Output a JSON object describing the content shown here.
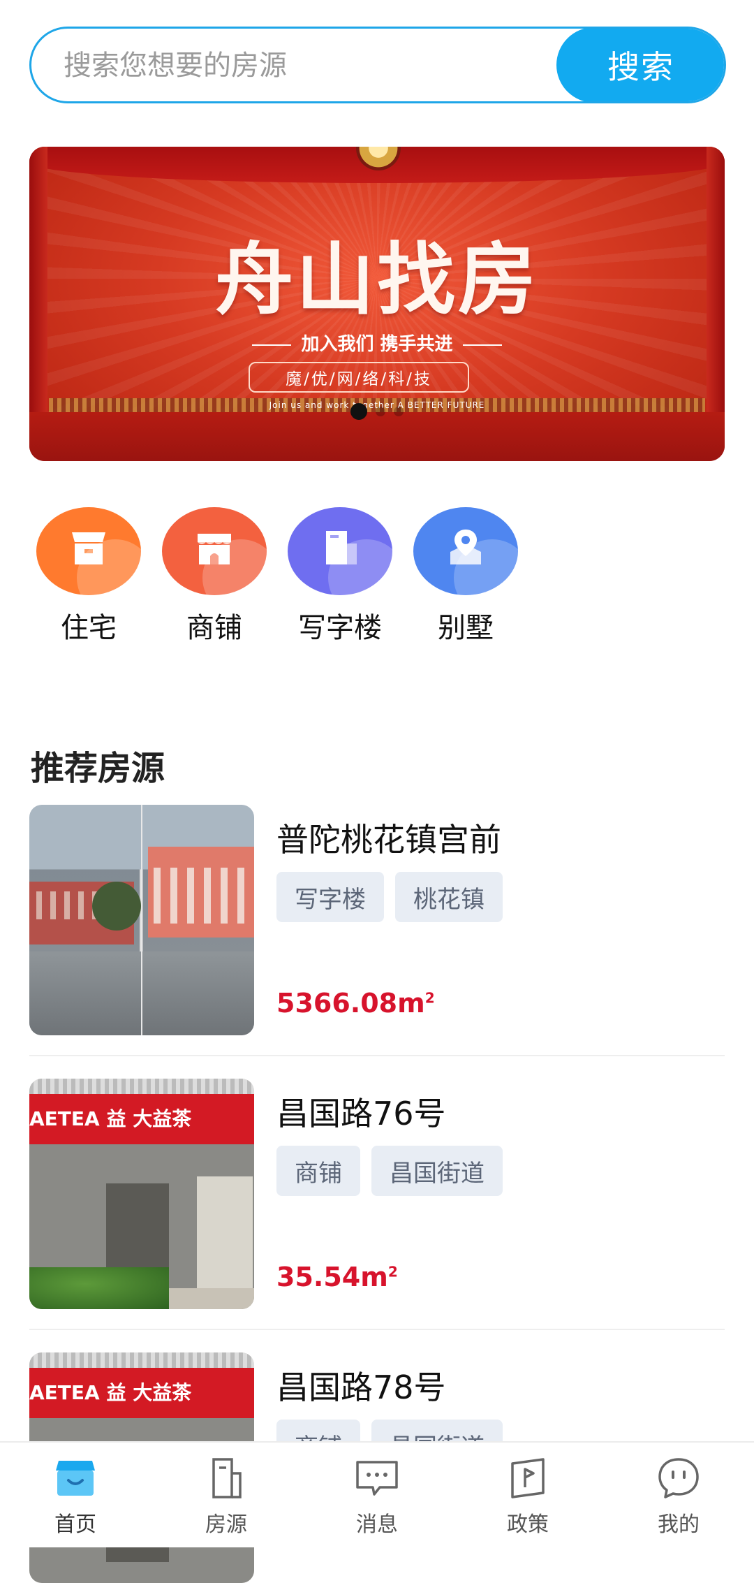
{
  "search": {
    "placeholder": "搜索您想要的房源",
    "button_label": "搜索"
  },
  "banner": {
    "title": "舟山找房",
    "subtitle": "加入我们 携手共进",
    "tag": "魔/优/网/络/科/技",
    "english": "Join us and work together A BETTER FUTURE",
    "slide_count": 3,
    "active_slide": 1
  },
  "categories": [
    {
      "label": "住宅",
      "icon": "house-icon",
      "color": "#ff7a2e"
    },
    {
      "label": "商铺",
      "icon": "storefront-icon",
      "color": "#f3613f"
    },
    {
      "label": "写字楼",
      "icon": "office-building-icon",
      "color": "#6f6ef0"
    },
    {
      "label": "别墅",
      "icon": "map-pin-icon",
      "color": "#4f86f0"
    }
  ],
  "section": {
    "title": "推荐房源"
  },
  "listings": [
    {
      "name": "普陀桃花镇宫前",
      "tags": [
        "写字楼",
        "桃花镇"
      ],
      "area": "5366.08",
      "unit": "m",
      "unit_sup": "2"
    },
    {
      "name": "昌国路76号",
      "tags": [
        "商铺",
        "昌国街道"
      ],
      "area": "35.54",
      "unit": "m",
      "unit_sup": "2"
    },
    {
      "name": "昌国路78号",
      "tags": [
        "商铺",
        "昌国街道"
      ],
      "area": "",
      "unit": "",
      "unit_sup": ""
    }
  ],
  "shop_sign": "AETEA 益 大益茶",
  "nav": {
    "items": [
      {
        "label": "首页",
        "icon": "home-icon",
        "active": true
      },
      {
        "label": "房源",
        "icon": "document-icon",
        "active": false
      },
      {
        "label": "消息",
        "icon": "message-icon",
        "active": false
      },
      {
        "label": "政策",
        "icon": "policy-flag-icon",
        "active": false
      },
      {
        "label": "我的",
        "icon": "profile-chat-icon",
        "active": false
      }
    ]
  },
  "colors": {
    "accent": "#12aaf0",
    "price": "#d7132c",
    "tag_bg": "#e8edf4"
  }
}
